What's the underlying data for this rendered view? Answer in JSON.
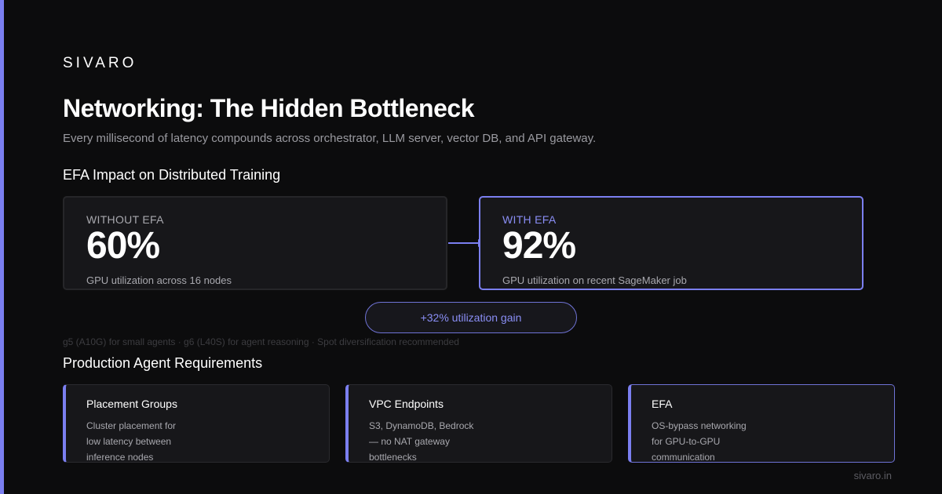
{
  "brand": "SIVARO",
  "title": "Networking: The Hidden Bottleneck",
  "subtitle": "Every millisecond of latency compounds across orchestrator, LLM server, vector DB, and API gateway.",
  "efa_section": {
    "heading": "EFA Impact on Distributed Training",
    "without": {
      "label": "WITHOUT EFA",
      "value": "60%",
      "description": "GPU utilization across 16 nodes"
    },
    "with": {
      "label": "WITH EFA",
      "value": "92%",
      "description": "GPU utilization on recent SageMaker job"
    },
    "gain": "+32% utilization gain",
    "note": "g5 (A10G) for small agents · g6 (L40S) for agent reasoning · Spot diversification recommended"
  },
  "requirements_section": {
    "heading": "Production Agent Requirements",
    "cards": [
      {
        "title": "Placement Groups",
        "description": "Cluster placement for low latency between inference nodes"
      },
      {
        "title": "VPC Endpoints",
        "description": "S3, DynamoDB, Bedrock — no NAT gateway bottlenecks"
      },
      {
        "title": "EFA",
        "description": "OS-bypass networking for GPU-to-GPU communication"
      }
    ]
  },
  "footer": {
    "url": "sivaro.in"
  },
  "colors": {
    "accent": "#7b7ff0",
    "background": "#0c0c0d",
    "card": "#17171a"
  }
}
